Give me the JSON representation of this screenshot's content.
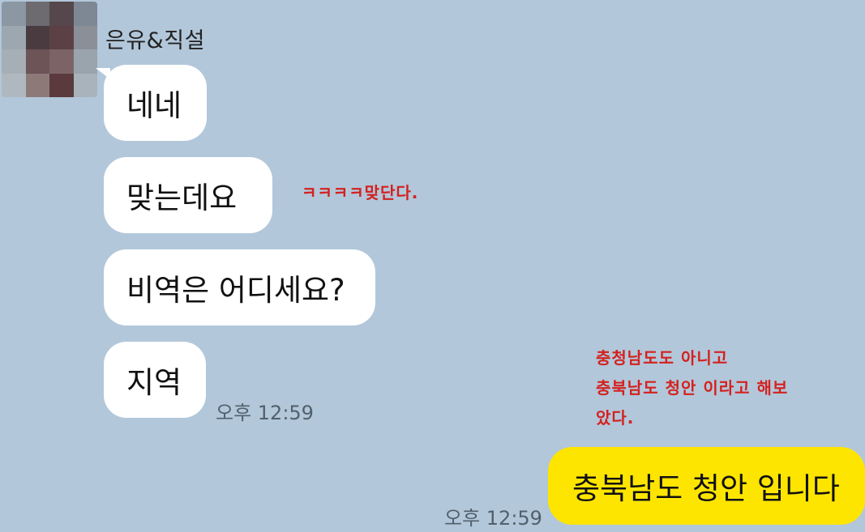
{
  "chat": {
    "sender_name": "은유&직설",
    "incoming": [
      "네네",
      "맞는데요",
      "비역은 어디세요?",
      "지역"
    ],
    "incoming_time": "오후 12:59",
    "outgoing": "충북남도 청안 입니다",
    "outgoing_time": "오후 12:59"
  },
  "annotations": {
    "note1": "ㅋㅋㅋㅋ맞단다.",
    "note2_line1": "충청남도도 아니고",
    "note2_line2": "충북남도 청안 이라고 해보",
    "note2_line3": "았다."
  },
  "colors": {
    "background": "#b2c7da",
    "incoming_bubble": "#ffffff",
    "outgoing_bubble": "#fee500",
    "annotation": "#d4211e"
  }
}
